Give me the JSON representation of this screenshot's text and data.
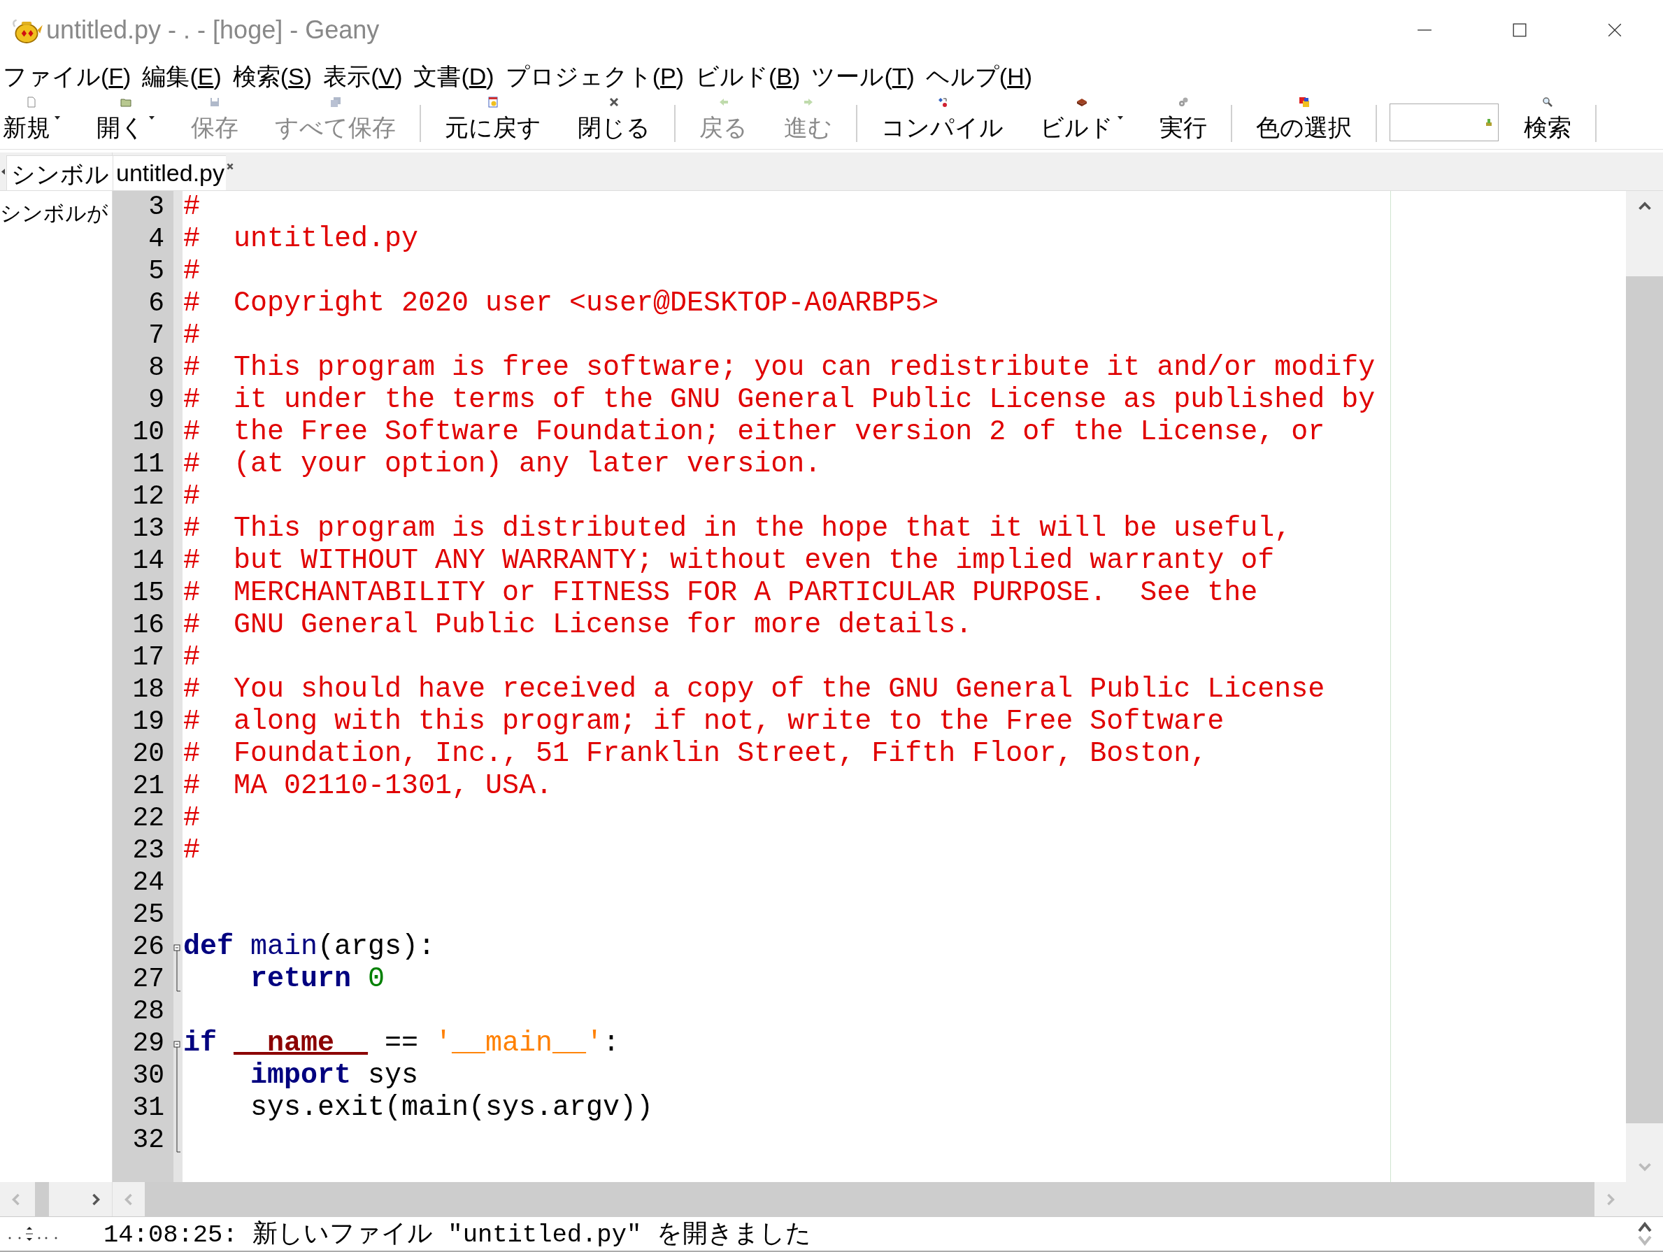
{
  "window": {
    "title": "untitled.py - . - [hoge] - Geany"
  },
  "menu": [
    {
      "label": "ファイル(",
      "key": "F",
      "tail": ")"
    },
    {
      "label": "編集(",
      "key": "E",
      "tail": ")"
    },
    {
      "label": "検索(",
      "key": "S",
      "tail": ")"
    },
    {
      "label": "表示(",
      "key": "V",
      "tail": ")"
    },
    {
      "label": "文書(",
      "key": "D",
      "tail": ")"
    },
    {
      "label": "プロジェクト(",
      "key": "P",
      "tail": ")"
    },
    {
      "label": "ビルド(",
      "key": "B",
      "tail": ")"
    },
    {
      "label": "ツール(",
      "key": "T",
      "tail": ")"
    },
    {
      "label": "ヘルプ(",
      "key": "H",
      "tail": ")"
    }
  ],
  "toolbar": [
    {
      "kind": "button",
      "label": "新規",
      "disabled": false,
      "dropdown": true
    },
    {
      "kind": "button",
      "label": "開く",
      "disabled": false,
      "dropdown": true
    },
    {
      "kind": "button",
      "label": "保存",
      "disabled": true,
      "dropdown": false
    },
    {
      "kind": "button",
      "label": "すべて保存",
      "disabled": true,
      "dropdown": false
    },
    {
      "kind": "separator"
    },
    {
      "kind": "button",
      "label": "元に戻す",
      "disabled": false,
      "dropdown": false
    },
    {
      "kind": "button",
      "label": "閉じる",
      "disabled": false,
      "dropdown": false
    },
    {
      "kind": "separator"
    },
    {
      "kind": "button",
      "label": "戻る",
      "disabled": true,
      "dropdown": false
    },
    {
      "kind": "button",
      "label": "進む",
      "disabled": true,
      "dropdown": false
    },
    {
      "kind": "separator"
    },
    {
      "kind": "button",
      "label": "コンパイル",
      "disabled": false,
      "dropdown": false
    },
    {
      "kind": "button",
      "label": "ビルド",
      "disabled": false,
      "dropdown": true
    },
    {
      "kind": "button",
      "label": "実行",
      "disabled": false,
      "dropdown": false
    },
    {
      "kind": "separator"
    },
    {
      "kind": "button",
      "label": "色の選択",
      "disabled": false,
      "dropdown": false
    },
    {
      "kind": "separator"
    },
    {
      "kind": "field"
    },
    {
      "kind": "button",
      "label": "検索",
      "disabled": false,
      "dropdown": false
    },
    {
      "kind": "separator"
    }
  ],
  "sidebar": {
    "tabs": [
      {
        "label": "シンボル",
        "selected": true
      }
    ],
    "message": "シンボルが"
  },
  "editor": {
    "tabs": [
      {
        "label": "untitled.py",
        "selected": true
      }
    ],
    "lines": [
      {
        "number": "3",
        "tokens": [
          {
            "kind": "comment",
            "text": "#"
          }
        ]
      },
      {
        "number": "4",
        "tokens": [
          {
            "kind": "comment",
            "text": "#  untitled.py"
          }
        ]
      },
      {
        "number": "5",
        "tokens": [
          {
            "kind": "comment",
            "text": "#"
          }
        ]
      },
      {
        "number": "6",
        "tokens": [
          {
            "kind": "comment",
            "text": "#  Copyright 2020 user <user@DESKTOP-A0ARBP5>"
          }
        ]
      },
      {
        "number": "7",
        "tokens": [
          {
            "kind": "comment",
            "text": "#"
          }
        ]
      },
      {
        "number": "8",
        "tokens": [
          {
            "kind": "comment",
            "text": "#  This program is free software; you can redistribute it and/or modify"
          }
        ]
      },
      {
        "number": "9",
        "tokens": [
          {
            "kind": "comment",
            "text": "#  it under the terms of the GNU General Public License as published by"
          }
        ]
      },
      {
        "number": "10",
        "tokens": [
          {
            "kind": "comment",
            "text": "#  the Free Software Foundation; either version 2 of the License, or"
          }
        ]
      },
      {
        "number": "11",
        "tokens": [
          {
            "kind": "comment",
            "text": "#  (at your option) any later version."
          }
        ]
      },
      {
        "number": "12",
        "tokens": [
          {
            "kind": "comment",
            "text": "#"
          }
        ]
      },
      {
        "number": "13",
        "tokens": [
          {
            "kind": "comment",
            "text": "#  This program is distributed in the hope that it will be useful,"
          }
        ]
      },
      {
        "number": "14",
        "tokens": [
          {
            "kind": "comment",
            "text": "#  but WITHOUT ANY WARRANTY; without even the implied warranty of"
          }
        ]
      },
      {
        "number": "15",
        "tokens": [
          {
            "kind": "comment",
            "text": "#  MERCHANTABILITY or FITNESS FOR A PARTICULAR PURPOSE.  See the"
          }
        ]
      },
      {
        "number": "16",
        "tokens": [
          {
            "kind": "comment",
            "text": "#  GNU General Public License for more details."
          }
        ]
      },
      {
        "number": "17",
        "tokens": [
          {
            "kind": "comment",
            "text": "#"
          }
        ]
      },
      {
        "number": "18",
        "tokens": [
          {
            "kind": "comment",
            "text": "#  You should have received a copy of the GNU General Public License"
          }
        ]
      },
      {
        "number": "19",
        "tokens": [
          {
            "kind": "comment",
            "text": "#  along with this program; if not, write to the Free Software"
          }
        ]
      },
      {
        "number": "20",
        "tokens": [
          {
            "kind": "comment",
            "text": "#  Foundation, Inc., 51 Franklin Street, Fifth Floor, Boston,"
          }
        ]
      },
      {
        "number": "21",
        "tokens": [
          {
            "kind": "comment",
            "text": "#  MA 02110-1301, USA."
          }
        ]
      },
      {
        "number": "22",
        "tokens": [
          {
            "kind": "comment",
            "text": "#"
          }
        ]
      },
      {
        "number": "23",
        "tokens": [
          {
            "kind": "comment",
            "text": "#"
          }
        ]
      },
      {
        "number": "24",
        "kind": "plain"
      },
      {
        "number": "25",
        "kind": "plain"
      },
      {
        "number": "26",
        "kind": "fold_start",
        "indented": false,
        "tokens": [
          {
            "kind": "keyword",
            "text": "def "
          },
          {
            "kind": "function",
            "text": "main"
          },
          {
            "kind": "plain",
            "text": "(args):"
          }
        ]
      },
      {
        "number": "27",
        "kind": "fold_end",
        "indented": true,
        "tokens": [
          {
            "kind": "keyword",
            "text": "return "
          },
          {
            "kind": "number",
            "text": "0"
          }
        ]
      },
      {
        "number": "28",
        "kind": "plain"
      },
      {
        "number": "29",
        "kind": "fold_start",
        "indented": false,
        "tokens": [
          {
            "kind": "keyword",
            "text": "if "
          },
          {
            "kind": "dunder",
            "text": "__name__"
          },
          {
            "kind": "plain",
            "text": " == "
          },
          {
            "kind": "string",
            "text": "'__main__'"
          },
          {
            "kind": "plain",
            "text": ":"
          }
        ]
      },
      {
        "number": "30",
        "kind": "fold_body",
        "indented": true,
        "tokens": [
          {
            "kind": "keyword",
            "text": "import "
          },
          {
            "kind": "plain",
            "text": "sys"
          }
        ]
      },
      {
        "number": "31",
        "kind": "fold_body",
        "indented": true,
        "tokens": [
          {
            "kind": "plain",
            "text": "sys.exit(main(sys.argv))"
          }
        ]
      },
      {
        "number": "32",
        "kind": "fold_end"
      }
    ]
  },
  "status_bar": {
    "message": "14:08:25: 新しいファイル \"untitled.py\" を開きました"
  }
}
